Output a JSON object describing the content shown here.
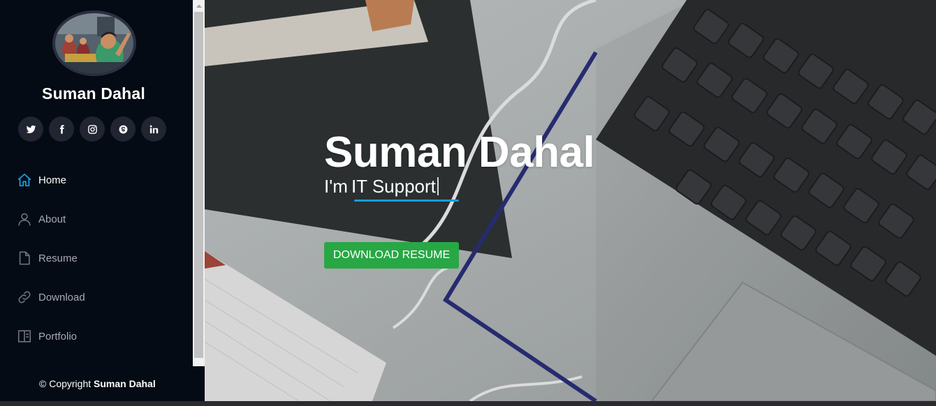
{
  "profile": {
    "name": "Suman Dahal"
  },
  "social": [
    {
      "name": "twitter-icon"
    },
    {
      "name": "facebook-icon"
    },
    {
      "name": "instagram-icon"
    },
    {
      "name": "skype-icon"
    },
    {
      "name": "linkedin-icon"
    }
  ],
  "nav": {
    "items": [
      {
        "label": "Home",
        "icon": "home-icon",
        "active": true
      },
      {
        "label": "About",
        "icon": "user-icon",
        "active": false
      },
      {
        "label": "Resume",
        "icon": "document-icon",
        "active": false
      },
      {
        "label": "Download",
        "icon": "link-icon",
        "active": false
      },
      {
        "label": "Portfolio",
        "icon": "layout-icon",
        "active": false
      }
    ]
  },
  "footer": {
    "copyright_prefix": "© Copyright",
    "copyright_name": "Suman Dahal"
  },
  "hero": {
    "title": "Suman Dahal",
    "subtitle_prefix": "I'm",
    "subtitle_typed": "IT Support",
    "button_label": "DOWNLOAD RESUME"
  },
  "colors": {
    "accent": "#149ddd",
    "sidebar_bg": "#040b14",
    "button_bg": "#28a745",
    "nav_text": "#a8a9b4"
  }
}
